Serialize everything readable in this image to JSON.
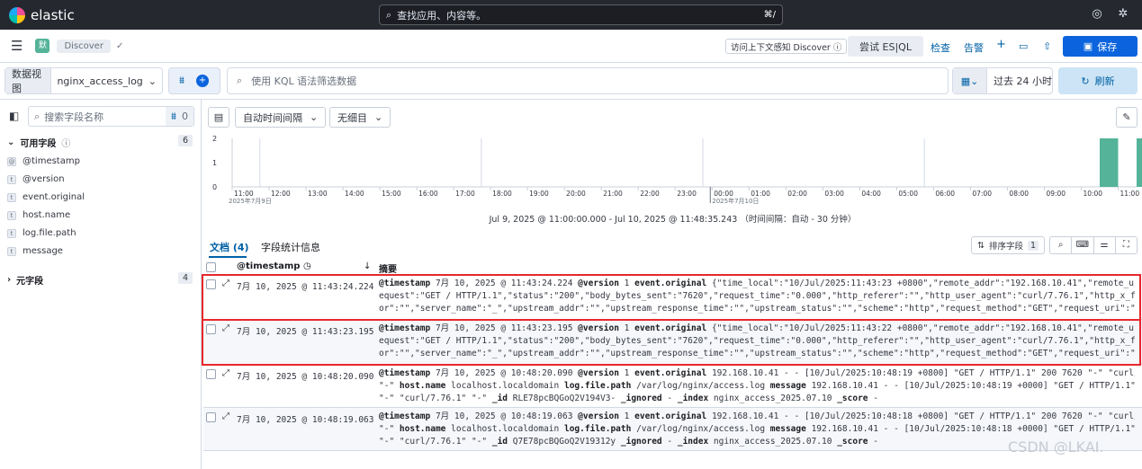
{
  "top": {
    "brand": "elastic",
    "search_placeholder": "查找应用、内容等。",
    "shortcut": "⌘/"
  },
  "nav": {
    "space": "默",
    "breadcrumb": "Discover"
  },
  "actions": {
    "context": "访问上下文感知 Discover",
    "esql": "尝试 ES|QL",
    "inspect": "检查",
    "alert": "告警",
    "save": "保存"
  },
  "query": {
    "dataview_label": "数据视图",
    "dataview": "nginx_access_log",
    "kql_placeholder": "使用 KQL 语法筛选数据",
    "time": "过去 24 小时",
    "refresh": "刷新"
  },
  "sidebar": {
    "search_placeholder": "搜索字段名称",
    "filter_count": "0",
    "available_label": "可用字段",
    "available_count": "6",
    "fields": [
      {
        "type": "@",
        "name": "@timestamp"
      },
      {
        "type": "t",
        "name": "@version"
      },
      {
        "type": "t",
        "name": "event.original"
      },
      {
        "type": "t",
        "name": "host.name"
      },
      {
        "type": "t",
        "name": "log.file.path"
      },
      {
        "type": "t",
        "name": "message"
      }
    ],
    "meta_label": "元字段",
    "meta_count": "4"
  },
  "chartbar": {
    "interval": "自动时间间隔",
    "breakdown": "无细目"
  },
  "chart_data": {
    "type": "bar",
    "y_ticks": [
      "2",
      "1",
      "0"
    ],
    "ylim": [
      0,
      2
    ],
    "x_ticks": [
      "11:00",
      "12:00",
      "13:00",
      "14:00",
      "15:00",
      "16:00",
      "17:00",
      "18:00",
      "19:00",
      "20:00",
      "21:00",
      "22:00",
      "23:00",
      "00:00",
      "01:00",
      "02:00",
      "03:00",
      "04:00",
      "05:00",
      "06:00",
      "07:00",
      "08:00",
      "09:00",
      "10:00",
      "11:00"
    ],
    "x_sub": {
      "first": "2025年7月9日",
      "midnight": "2025年7月10日"
    },
    "bars": [
      {
        "time": "10:30",
        "value": 2
      },
      {
        "time": "11:30",
        "value": 2
      }
    ],
    "range_label": "Jul 9, 2025 @ 11:00:00.000 - Jul 10, 2025 @ 11:48:35.243 （时间间隔：自动 - 30 分钟）"
  },
  "tabs": {
    "docs": "文档 (4)",
    "stats": "字段统计信息"
  },
  "table": {
    "sort_label": "排序字段",
    "sort_count": "1",
    "col_ts": "@timestamp",
    "col_summary": "摘要"
  },
  "rows": [
    {
      "ts": "7月 10, 2025 @ 11:43:24.224",
      "l1": [
        [
          "@timestamp",
          "7月 10, 2025 @ 11:43:24.224"
        ],
        [
          "@version",
          "1"
        ],
        [
          "event.original",
          "{\"time_local\":\"10/Jul/2025:11:43:23 +0800\",\"remote_addr\":\"192.168.10.41\",\"remote_user\":\"\",\"r"
        ]
      ],
      "l2": "equest\":\"GET / HTTP/1.1\",\"status\":\"200\",\"body_bytes_sent\":\"7620\",\"request_time\":\"0.000\",\"http_referer\":\"\",\"http_user_agent\":\"curl/7.76.1\",\"http_x_forwarded_f",
      "l3": "or\":\"\",\"server_name\":\"_\",\"upstream_addr\":\"\",\"upstream_response_time\":\"\",\"upstream_status\":\"\",\"scheme\":\"http\",\"request_method\":\"GET\",\"request_uri\":\"/\",\"serve..."
    },
    {
      "ts": "7月 10, 2025 @ 11:43:23.195",
      "l1": [
        [
          "@timestamp",
          "7月 10, 2025 @ 11:43:23.195"
        ],
        [
          "@version",
          "1"
        ],
        [
          "event.original",
          "{\"time_local\":\"10/Jul/2025:11:43:22 +0800\",\"remote_addr\":\"192.168.10.41\",\"remote_user\":\"\",\"r"
        ]
      ],
      "l2": "equest\":\"GET / HTTP/1.1\",\"status\":\"200\",\"body_bytes_sent\":\"7620\",\"request_time\":\"0.000\",\"http_referer\":\"\",\"http_user_agent\":\"curl/7.76.1\",\"http_x_forwarded_f",
      "l3": "or\":\"\",\"server_name\":\"_\",\"upstream_addr\":\"\",\"upstream_response_time\":\"\",\"upstream_status\":\"\",\"scheme\":\"http\",\"request_method\":\"GET\",\"request_uri\":\"/\",\"serve..."
    },
    {
      "ts": "7月 10, 2025 @ 10:48:20.090",
      "l1": [
        [
          "@timestamp",
          "7月 10, 2025 @ 10:48:20.090"
        ],
        [
          "@version",
          "1"
        ],
        [
          "event.original",
          "192.168.10.41 - - [10/Jul/2025:10:48:19 +0800] \"GET / HTTP/1.1\" 200 7620 \"-\" \"curl/7.76.1\""
        ]
      ],
      "l2pairs": [
        [
          "",
          "\"-\""
        ],
        [
          "host.name",
          "localhost.localdomain"
        ],
        [
          "log.file.path",
          "/var/log/nginx/access.log"
        ],
        [
          "message",
          "192.168.10.41 - - [10/Jul/2025:10:48:19 +0000] \"GET / HTTP/1.1\" 200 7620"
        ]
      ],
      "l3pairs": [
        [
          "",
          "\"-\" \"curl/7.76.1\" \"-\""
        ],
        [
          "_id",
          "RLE78pcBQGoQ2V194V3-"
        ],
        [
          "_ignored",
          "-"
        ],
        [
          "_index",
          "nginx_access_2025.07.10"
        ],
        [
          "_score",
          "-"
        ]
      ]
    },
    {
      "ts": "7月 10, 2025 @ 10:48:19.063",
      "l1": [
        [
          "@timestamp",
          "7月 10, 2025 @ 10:48:19.063"
        ],
        [
          "@version",
          "1"
        ],
        [
          "event.original",
          "192.168.10.41 - - [10/Jul/2025:10:48:18 +0800] \"GET / HTTP/1.1\" 200 7620 \"-\" \"curl/7.76.1\""
        ]
      ],
      "l2pairs": [
        [
          "",
          "\"-\""
        ],
        [
          "host.name",
          "localhost.localdomain"
        ],
        [
          "log.file.path",
          "/var/log/nginx/access.log"
        ],
        [
          "message",
          "192.168.10.41 - - [10/Jul/2025:10:48:18 +0000] \"GET / HTTP/1.1\" 200 7620"
        ]
      ],
      "l3pairs": [
        [
          "",
          "\"-\" \"curl/7.76.1\" \"-\""
        ],
        [
          "_id",
          "Q7E78pcBQGoQ2V19312y"
        ],
        [
          "_ignored",
          "-"
        ],
        [
          "_index",
          "nginx_access_2025.07.10"
        ],
        [
          "_score",
          "-"
        ]
      ]
    }
  ],
  "watermark": "CSDN @LKAI."
}
